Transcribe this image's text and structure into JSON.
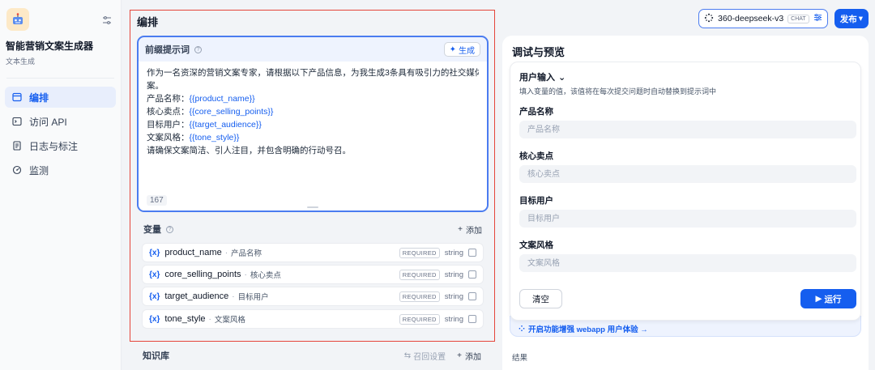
{
  "app": {
    "name": "智能营销文案生成器",
    "type": "文本生成"
  },
  "sidebar": {
    "items": [
      {
        "label": "编排",
        "icon": "layout-icon",
        "active": true
      },
      {
        "label": "访问 API",
        "icon": "terminal-icon",
        "active": false
      },
      {
        "label": "日志与标注",
        "icon": "file-list-icon",
        "active": false
      },
      {
        "label": "监测",
        "icon": "monitor-icon",
        "active": false
      }
    ]
  },
  "orchestration": {
    "title": "编排",
    "prompt": {
      "label": "前缀提示词",
      "generate_label": "生成",
      "lines": [
        "作为一名资深的营销文案专家，请根据以下产品信息，为我生成3条具有吸引力的社交媒体推广文",
        "案。"
      ],
      "fields": [
        {
          "label": "产品名称：",
          "var": "{{product_name}}"
        },
        {
          "label": "核心卖点：",
          "var": "{{core_selling_points}}"
        },
        {
          "label": "目标用户：",
          "var": "{{target_audience}}"
        },
        {
          "label": "文案风格：",
          "var": "{{tone_style}}"
        }
      ],
      "closing": "请确保文案简洁、引人注目，并包含明确的行动号召。",
      "char_count": "167"
    },
    "variables": {
      "title": "变量",
      "add_label": "添加",
      "items": [
        {
          "key": "product_name",
          "label": "产品名称",
          "required": "REQUIRED",
          "type": "string"
        },
        {
          "key": "core_selling_points",
          "label": "核心卖点",
          "required": "REQUIRED",
          "type": "string"
        },
        {
          "key": "target_audience",
          "label": "目标用户",
          "required": "REQUIRED",
          "type": "string"
        },
        {
          "key": "tone_style",
          "label": "文案风格",
          "required": "REQUIRED",
          "type": "string"
        }
      ]
    },
    "knowledge": {
      "title": "知识库",
      "recall_label": "召回设置",
      "add_label": "添加"
    }
  },
  "topbar": {
    "model_name": "360-deepseek-v3",
    "model_mode": "CHAT",
    "publish_label": "发布"
  },
  "debug": {
    "title": "调试与预览",
    "user_input_label": "用户输入",
    "hint": "填入变量的值，该值将在每次提交问题时自动替换到提示词中",
    "fields": [
      {
        "label": "产品名称",
        "placeholder": "产品名称"
      },
      {
        "label": "核心卖点",
        "placeholder": "核心卖点"
      },
      {
        "label": "目标用户",
        "placeholder": "目标用户"
      },
      {
        "label": "文案风格",
        "placeholder": "文案风格"
      }
    ],
    "clear_label": "清空",
    "run_label": "运行",
    "enhance_label": "开启功能增强 webapp 用户体验 →",
    "result_label": "结果"
  },
  "colors": {
    "accent": "#155eef",
    "highlight_border": "#e5453a",
    "active_nav_bg": "#e8eefc"
  }
}
